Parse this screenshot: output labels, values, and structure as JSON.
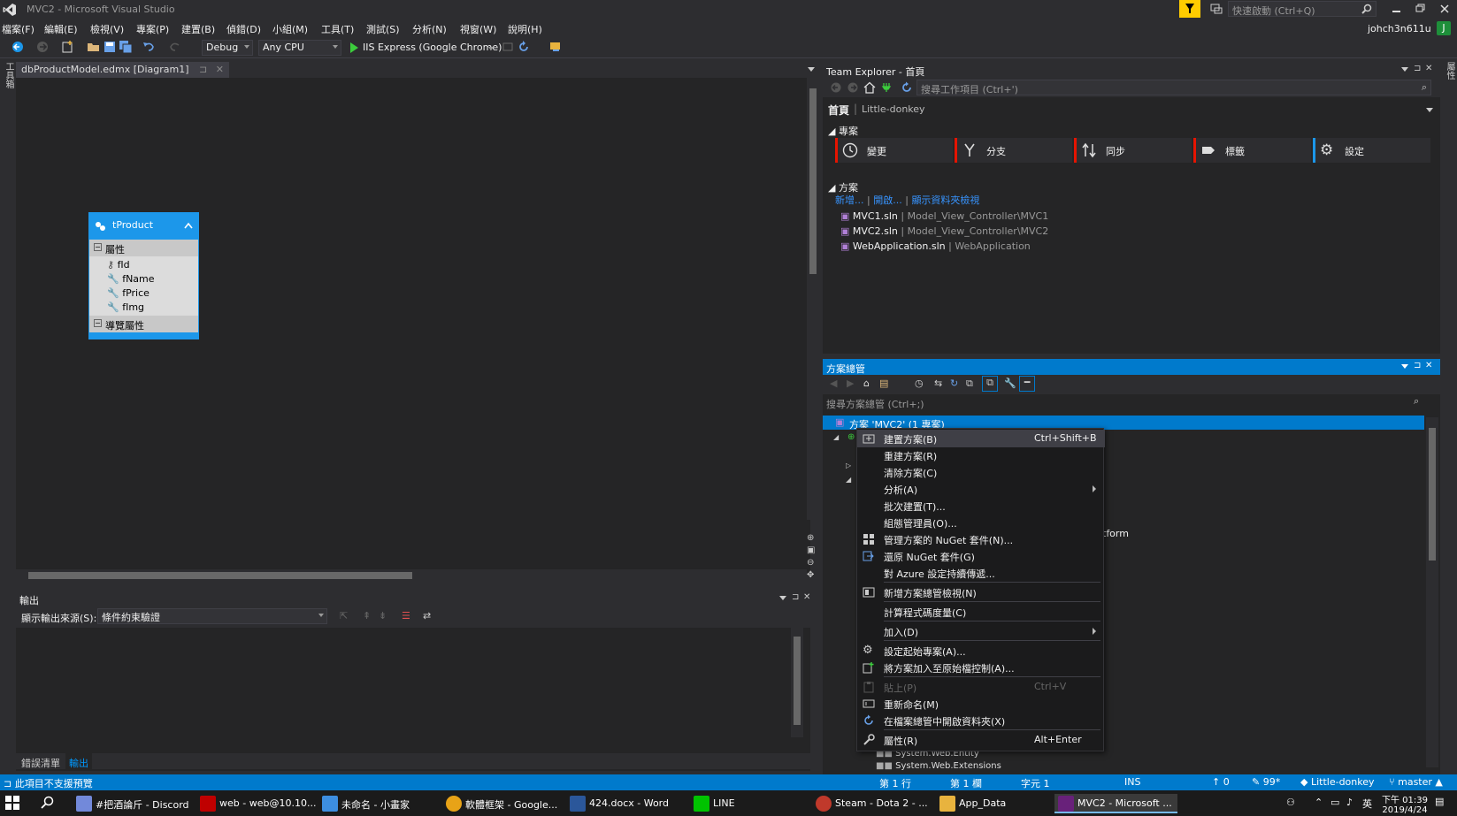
{
  "window": {
    "title": "MVC2 - Microsoft Visual Studio",
    "quick_launch_placeholder": "快速啟動 (Ctrl+Q)",
    "user": "johch3n611u",
    "user_initial": "J"
  },
  "menu": [
    "檔案(F)",
    "編輯(E)",
    "檢視(V)",
    "專案(P)",
    "建置(B)",
    "偵錯(D)",
    "小組(M)",
    "工具(T)",
    "測試(S)",
    "分析(N)",
    "視窗(W)",
    "說明(H)"
  ],
  "toolbar": {
    "config": "Debug",
    "platform": "Any CPU",
    "run_target": "IIS Express (Google Chrome)"
  },
  "left_strip": {
    "toolbox": "工具箱"
  },
  "right_strip": {
    "properties": "屬性"
  },
  "editor": {
    "tab_label": "dbProductModel.edmx [Diagram1]",
    "entity": {
      "name": "tProduct",
      "section_props": "屬性",
      "section_nav": "導覽屬性",
      "properties": [
        "fId",
        "fName",
        "fPrice",
        "fImg"
      ]
    }
  },
  "output": {
    "title": "輸出",
    "source_label": "顯示輸出來源(S):",
    "source_value": "條件約束驗證",
    "tabs": [
      "錯誤清單",
      "輸出"
    ]
  },
  "team_explorer": {
    "title": "Team Explorer - 首頁",
    "search_placeholder": "搜尋工作項目 (Ctrl+')",
    "home_label": "首頁",
    "repo_name": "Little-donkey",
    "section_project": "專案",
    "buttons": [
      {
        "label": "變更",
        "color": "#e51400"
      },
      {
        "label": "分支",
        "color": "#e51400"
      },
      {
        "label": "同步",
        "color": "#e51400"
      },
      {
        "label": "標籤",
        "color": "#e51400"
      },
      {
        "label": "設定",
        "color": "#1c97ea"
      }
    ],
    "section_solution": "方案",
    "solution_links": [
      "新增...",
      "開啟...",
      "顯示資料夾檢視"
    ],
    "solutions": [
      {
        "name": "MVC1.sln",
        "path": "Model_View_Controller\\MVC1"
      },
      {
        "name": "MVC2.sln",
        "path": "Model_View_Controller\\MVC2"
      },
      {
        "name": "WebApplication.sln",
        "path": "WebApplication"
      }
    ]
  },
  "solution_explorer": {
    "title": "方案總管",
    "search_placeholder": "搜尋方案總管 (Ctrl+;)",
    "selected_node": "方案 'MVC2' (1 專案)",
    "partial_text": "tform",
    "tree_bottom": [
      "System.Web.Entity",
      "System.Web.Extensions"
    ]
  },
  "context_menu": {
    "items": [
      {
        "label": "建置方案(B)",
        "shortcut": "Ctrl+Shift+B",
        "icon": "build-icon",
        "hover": true
      },
      {
        "label": "重建方案(R)"
      },
      {
        "label": "清除方案(C)"
      },
      {
        "label": "分析(A)",
        "submenu": true
      },
      {
        "label": "批次建置(T)..."
      },
      {
        "label": "組態管理員(O)..."
      },
      {
        "label": "管理方案的 NuGet 套件(N)...",
        "icon": "nuget-icon"
      },
      {
        "label": "還原 NuGet 套件(G)",
        "icon": "restore-icon"
      },
      {
        "label": "對 Azure 設定持續傳遞...",
        "sep_after": true
      },
      {
        "label": "新增方案總管檢視(N)",
        "icon": "new-view-icon",
        "sep_after": true
      },
      {
        "label": "計算程式碼度量(C)",
        "sep_after": true
      },
      {
        "label": "加入(D)",
        "submenu": true,
        "sep_after": true
      },
      {
        "label": "設定起始專案(A)...",
        "icon": "gear-icon"
      },
      {
        "label": "將方案加入至原始檔控制(A)...",
        "icon": "source-control-icon",
        "sep_after": true
      },
      {
        "label": "貼上(P)",
        "shortcut": "Ctrl+V",
        "icon": "paste-icon",
        "disabled": true
      },
      {
        "label": "重新命名(M)",
        "icon": "rename-icon"
      },
      {
        "label": "在檔案總管中開啟資料夾(X)",
        "icon": "refresh-folder-icon",
        "sep_after": true
      },
      {
        "label": "屬性(R)",
        "shortcut": "Alt+Enter",
        "icon": "wrench-icon"
      }
    ]
  },
  "status": {
    "message": "此項目不支援預覽",
    "line": "第 1 行",
    "col": "第 1 欄",
    "char": "字元 1",
    "mode": "INS",
    "pushes": "0",
    "changes": "99*",
    "repo": "Little-donkey",
    "branch": "master"
  },
  "taskbar": {
    "apps": [
      {
        "label": "#把酒論斤 - Discord",
        "color": "#7289da"
      },
      {
        "label": "web - web@10.10...",
        "color": "#bf0000"
      },
      {
        "label": "未命名 - 小畫家",
        "color": "#3d8ee0"
      },
      {
        "label": "軟體框架 - Google...",
        "color": "#e8a317"
      },
      {
        "label": "424.docx - Word",
        "color": "#2b579a"
      },
      {
        "label": "LINE",
        "color": "#00c300"
      },
      {
        "label": "Steam - Dota 2 - ...",
        "color": "#c0392b"
      },
      {
        "label": "App_Data",
        "color": "#e8b33e"
      },
      {
        "label": "MVC2 - Microsoft ...",
        "color": "#68217a"
      }
    ],
    "ime": "英",
    "time": "下午 01:39",
    "date": "2019/4/24"
  }
}
